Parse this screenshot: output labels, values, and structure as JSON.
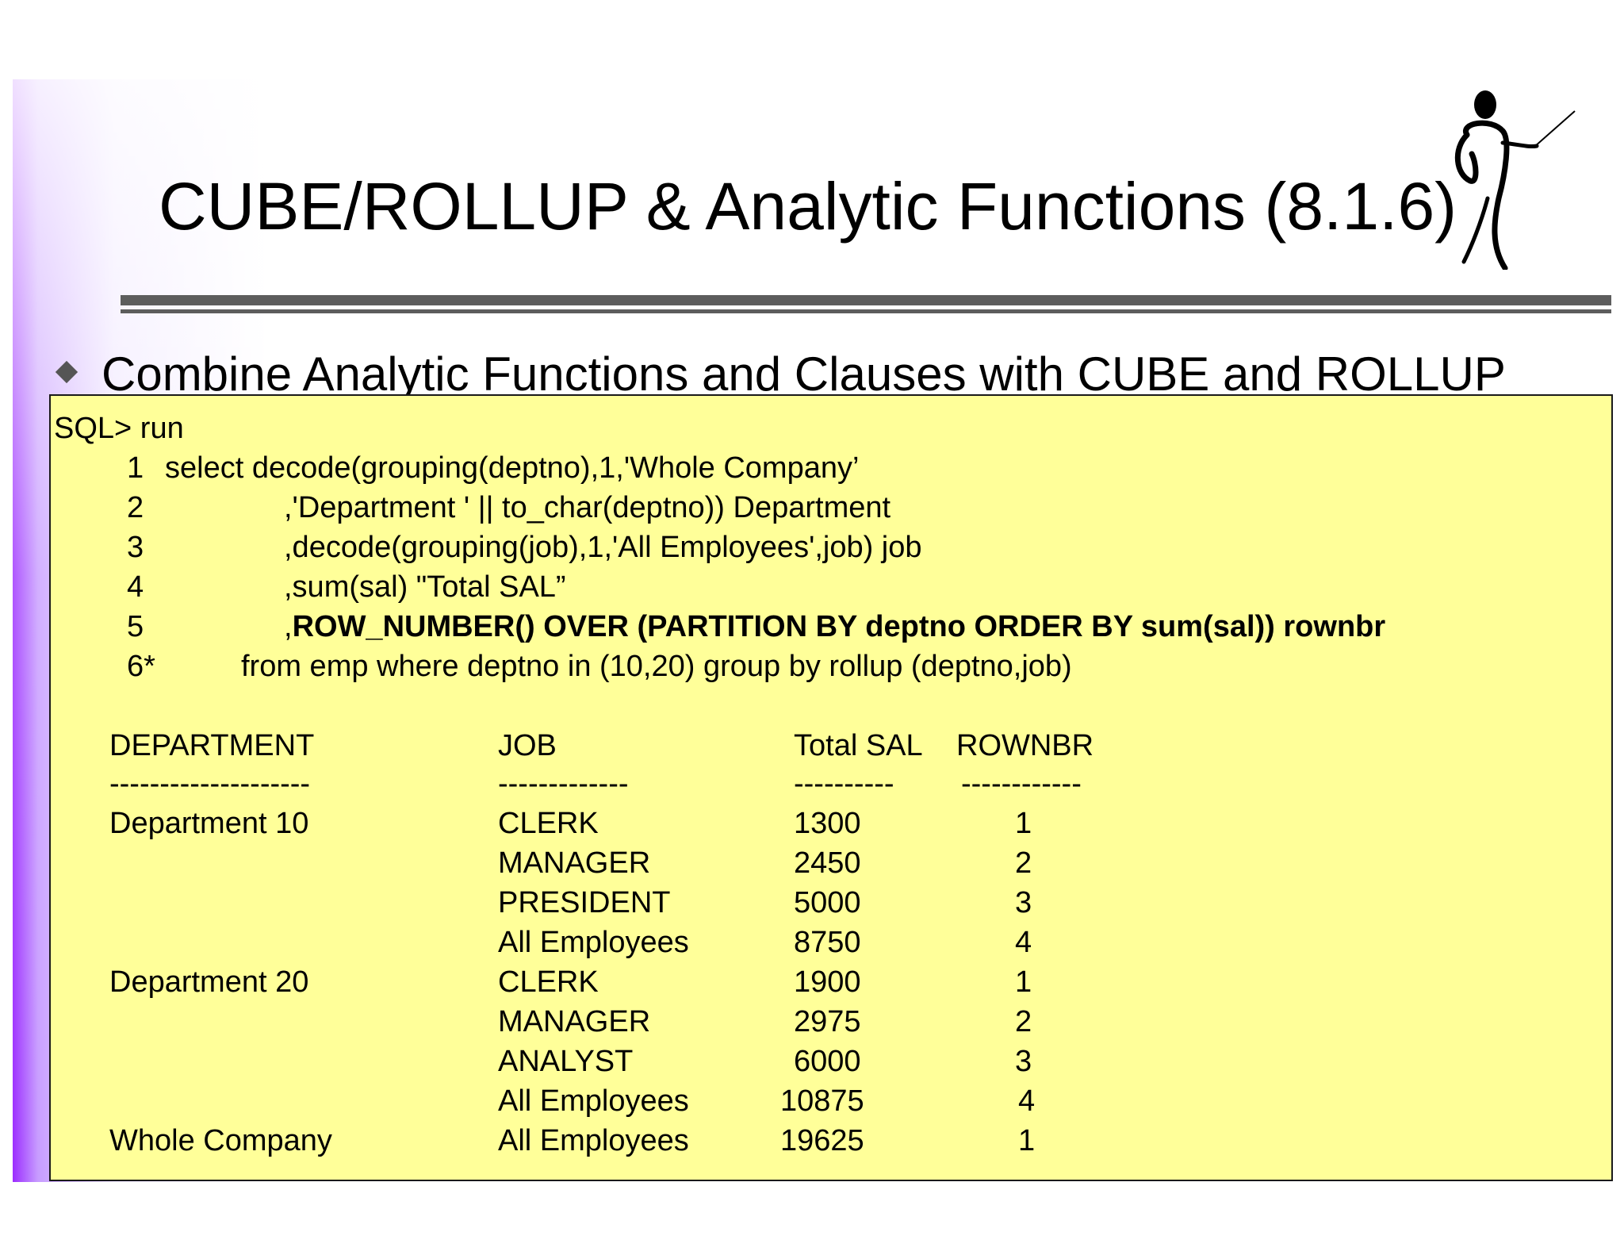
{
  "slide": {
    "title": "CUBE/ROLLUP & Analytic Functions (8.1.6)",
    "bullet": "Combine Analytic Functions and Clauses with CUBE and ROLLUP",
    "colors": {
      "box_fill": "#ffff99",
      "rule": "#5d5d5d",
      "side_bar": "#9b2cff"
    }
  },
  "sql": {
    "prompt": "SQL> run",
    "lines": [
      {
        "num": "1",
        "text": "select decode(grouping(deptno),1,'Whole Company’"
      },
      {
        "num": "2",
        "text": ",'Department ' || to_char(deptno)) Department"
      },
      {
        "num": "3",
        "text": ",decode(grouping(job),1,'All Employees',job) job"
      },
      {
        "num": "4",
        "text": ",sum(sal)  \"Total SAL”"
      },
      {
        "num": "5",
        "prefix": ",",
        "bold": "ROW_NUMBER() OVER (PARTITION BY deptno ORDER BY sum(sal)) rownbr"
      },
      {
        "num": "6*",
        "text": "from emp where deptno in (10,20) group by rollup (deptno,job)"
      }
    ]
  },
  "result": {
    "headers": [
      "DEPARTMENT",
      "JOB",
      "Total SAL",
      "ROWNBR"
    ],
    "separators": [
      "--------------------",
      "-------------",
      "----------",
      "------------"
    ],
    "rows": [
      [
        "Department 10",
        "CLERK",
        "1300",
        "1"
      ],
      [
        "",
        "MANAGER",
        "2450",
        "2"
      ],
      [
        "",
        "PRESIDENT",
        "5000",
        "3"
      ],
      [
        "",
        "All Employees",
        "8750",
        "4"
      ],
      [
        "Department 20",
        "CLERK",
        "1900",
        "1"
      ],
      [
        "",
        "MANAGER",
        "2975",
        "2"
      ],
      [
        "",
        "ANALYST",
        "6000",
        "3"
      ],
      [
        "",
        "All Employees",
        "10875",
        "4"
      ],
      [
        "Whole Company",
        "All Employees",
        "19625",
        "1"
      ]
    ]
  }
}
